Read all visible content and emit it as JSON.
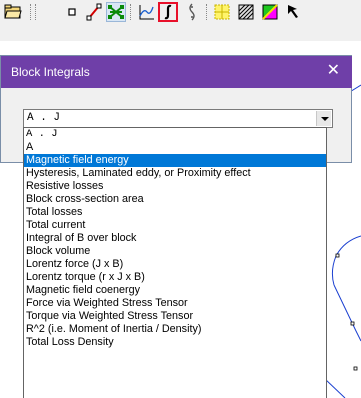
{
  "toolbar": {
    "buttons": [
      {
        "icon": "open-folder-icon"
      },
      {
        "icon": "node-mode-icon"
      },
      {
        "icon": "segment-mode-icon"
      },
      {
        "icon": "block-label-mode-icon"
      },
      {
        "icon": "plot-icon"
      },
      {
        "icon": "block-integral-icon",
        "selected": true
      },
      {
        "icon": "distribution-icon"
      },
      {
        "icon": "select-area-icon"
      },
      {
        "icon": "hatch-icon"
      },
      {
        "icon": "color-block-icon"
      },
      {
        "icon": "arrow-icon"
      }
    ]
  },
  "dialog": {
    "title": "Block Integrals",
    "close_glyph": "✕",
    "title_color": "#6f3fa8"
  },
  "combo": {
    "selected": "A . J"
  },
  "dropdown": {
    "highlight_color": "#0078d7",
    "options": [
      "A . J",
      "A",
      "Magnetic field energy",
      "Hysteresis, Laminated eddy, or Proximity effect",
      "Resistive losses",
      "Block cross-section area",
      "Total losses",
      "Total current",
      "Integral of B over block",
      "Block volume",
      "Lorentz force (J x B)",
      "Lorentz torque (r x J x B)",
      "Magnetic field coenergy",
      "Force via Weighted Stress Tensor",
      "Torque via Weighted Stress Tensor",
      "R^2 (i.e. Moment of Inertia / Density)",
      "Total Loss Density"
    ],
    "highlighted_index": 2
  }
}
